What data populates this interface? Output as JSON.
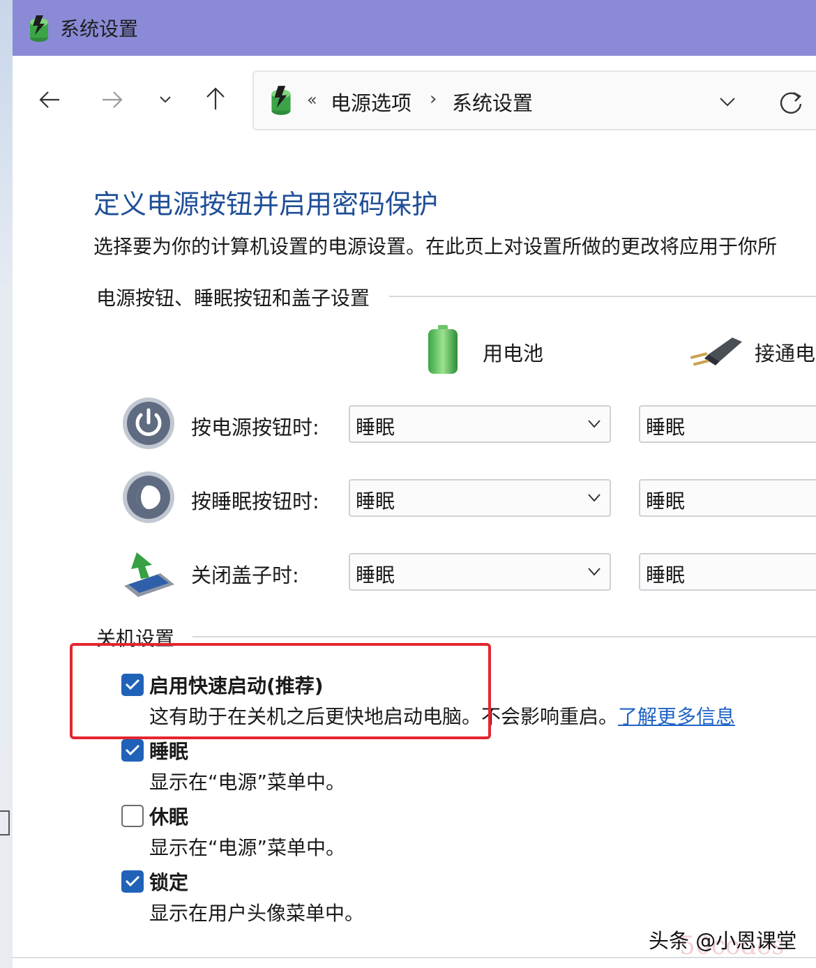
{
  "window": {
    "title": "系统设置"
  },
  "address_bar": {
    "overflow_marker": "«",
    "breadcrumb": [
      "电源选项",
      "系统设置"
    ],
    "separator": "›"
  },
  "page": {
    "heading": "定义电源按钮并启用密码保护",
    "description": "选择要为你的计算机设置的电源设置。在此页上对设置所做的更改将应用于你所"
  },
  "power_section": {
    "label": "电源按钮、睡眠按钮和盖子设置",
    "columns": {
      "battery": "用电池",
      "plugged_in": "接通电"
    },
    "rows": [
      {
        "label": "按电源按钮时:",
        "battery_value": "睡眠",
        "plugged_value": "睡眠"
      },
      {
        "label": "按睡眠按钮时:",
        "battery_value": "睡眠",
        "plugged_value": "睡眠"
      },
      {
        "label": "关闭盖子时:",
        "battery_value": "睡眠",
        "plugged_value": "睡眠"
      }
    ]
  },
  "shutdown_section": {
    "label": "关机设置",
    "options": [
      {
        "title": "启用快速启动(推荐)",
        "checked": true,
        "desc": "这有助于在关机之后更快地启动电脑。不会影响重启。",
        "link": "了解更多信息"
      },
      {
        "title": "睡眠",
        "checked": true,
        "desc": "显示在“电源”菜单中。"
      },
      {
        "title": "休眠",
        "checked": false,
        "desc": "显示在“电源”菜单中。"
      },
      {
        "title": "锁定",
        "checked": true,
        "desc": "显示在用户头像菜单中。"
      }
    ]
  },
  "watermark": {
    "text": "头条 @小恩课堂",
    "overlay": "50codes"
  },
  "colors": {
    "titlebar": "#8a8ad6",
    "heading": "#1f4e97",
    "checkbox": "#2062b8",
    "link": "#1f63c7",
    "highlight": "#e3262f"
  }
}
